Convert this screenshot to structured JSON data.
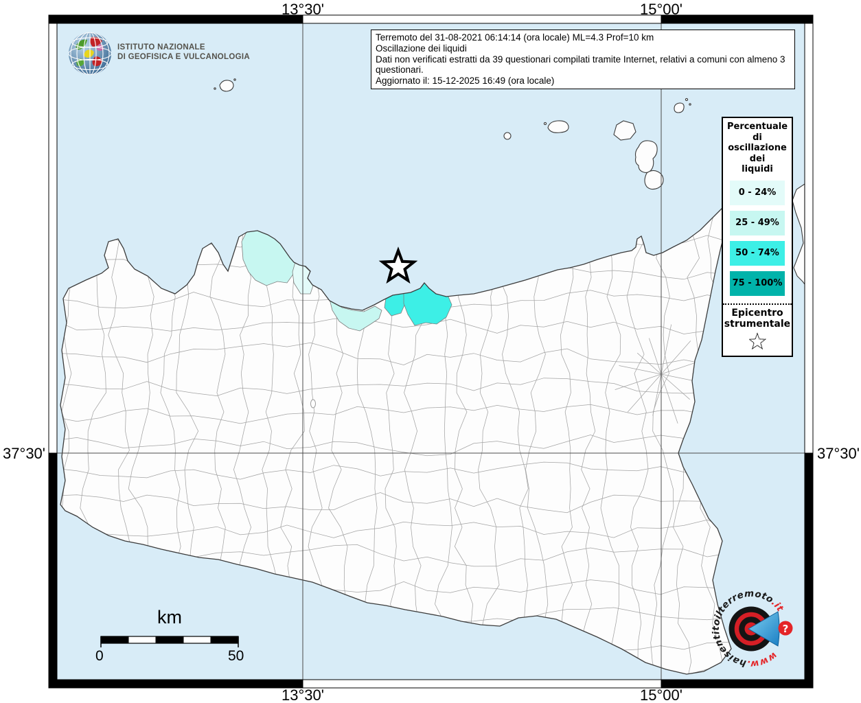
{
  "grid_labels": {
    "top_left": "13°30'",
    "top_right": "15°00'",
    "bottom_left": "13°30'",
    "bottom_right": "15°00'",
    "left": "37°30'",
    "right": "37°30'"
  },
  "info_box": {
    "lines": [
      "Terremoto del 31-08-2021 06:14:14 (ora locale) ML=4.3 Prof=10 km",
      "Oscillazione dei liquidi",
      "Dati non verificati estratti da 39 questionari compilati tramite Internet, relativi a comuni con almeno 3 questionari.",
      "Aggiornato il: 15-12-2025 16:49 (ora locale)"
    ]
  },
  "ingv_logo": {
    "line1": "ISTITUTO NAZIONALE",
    "line2": "DI GEOFISICA E VULCANOLOGIA"
  },
  "legend": {
    "title_lines": [
      "Percentuale",
      "di",
      "oscillazione",
      "dei",
      "liquidi"
    ],
    "classes": [
      {
        "label": "0 - 24%",
        "color": "#E3FBF9"
      },
      {
        "label": "25 - 49%",
        "color": "#C7F7F1"
      },
      {
        "label": "50 - 74%",
        "color": "#3DEFE6"
      },
      {
        "label": "75 - 100%",
        "color": "#00B3AA"
      }
    ],
    "epicenter_label_lines": [
      "Epicentro",
      "strumentale"
    ]
  },
  "scale_bar": {
    "unit": "km",
    "start_label": "0",
    "end_label": "50"
  },
  "watermark": {
    "prefix": "www.",
    "name": "haisentitoilterremoto",
    "tld": ".it",
    "badge": "?"
  },
  "map": {
    "sea_color": "#D8ECF7",
    "epicenter_symbol": "star"
  }
}
